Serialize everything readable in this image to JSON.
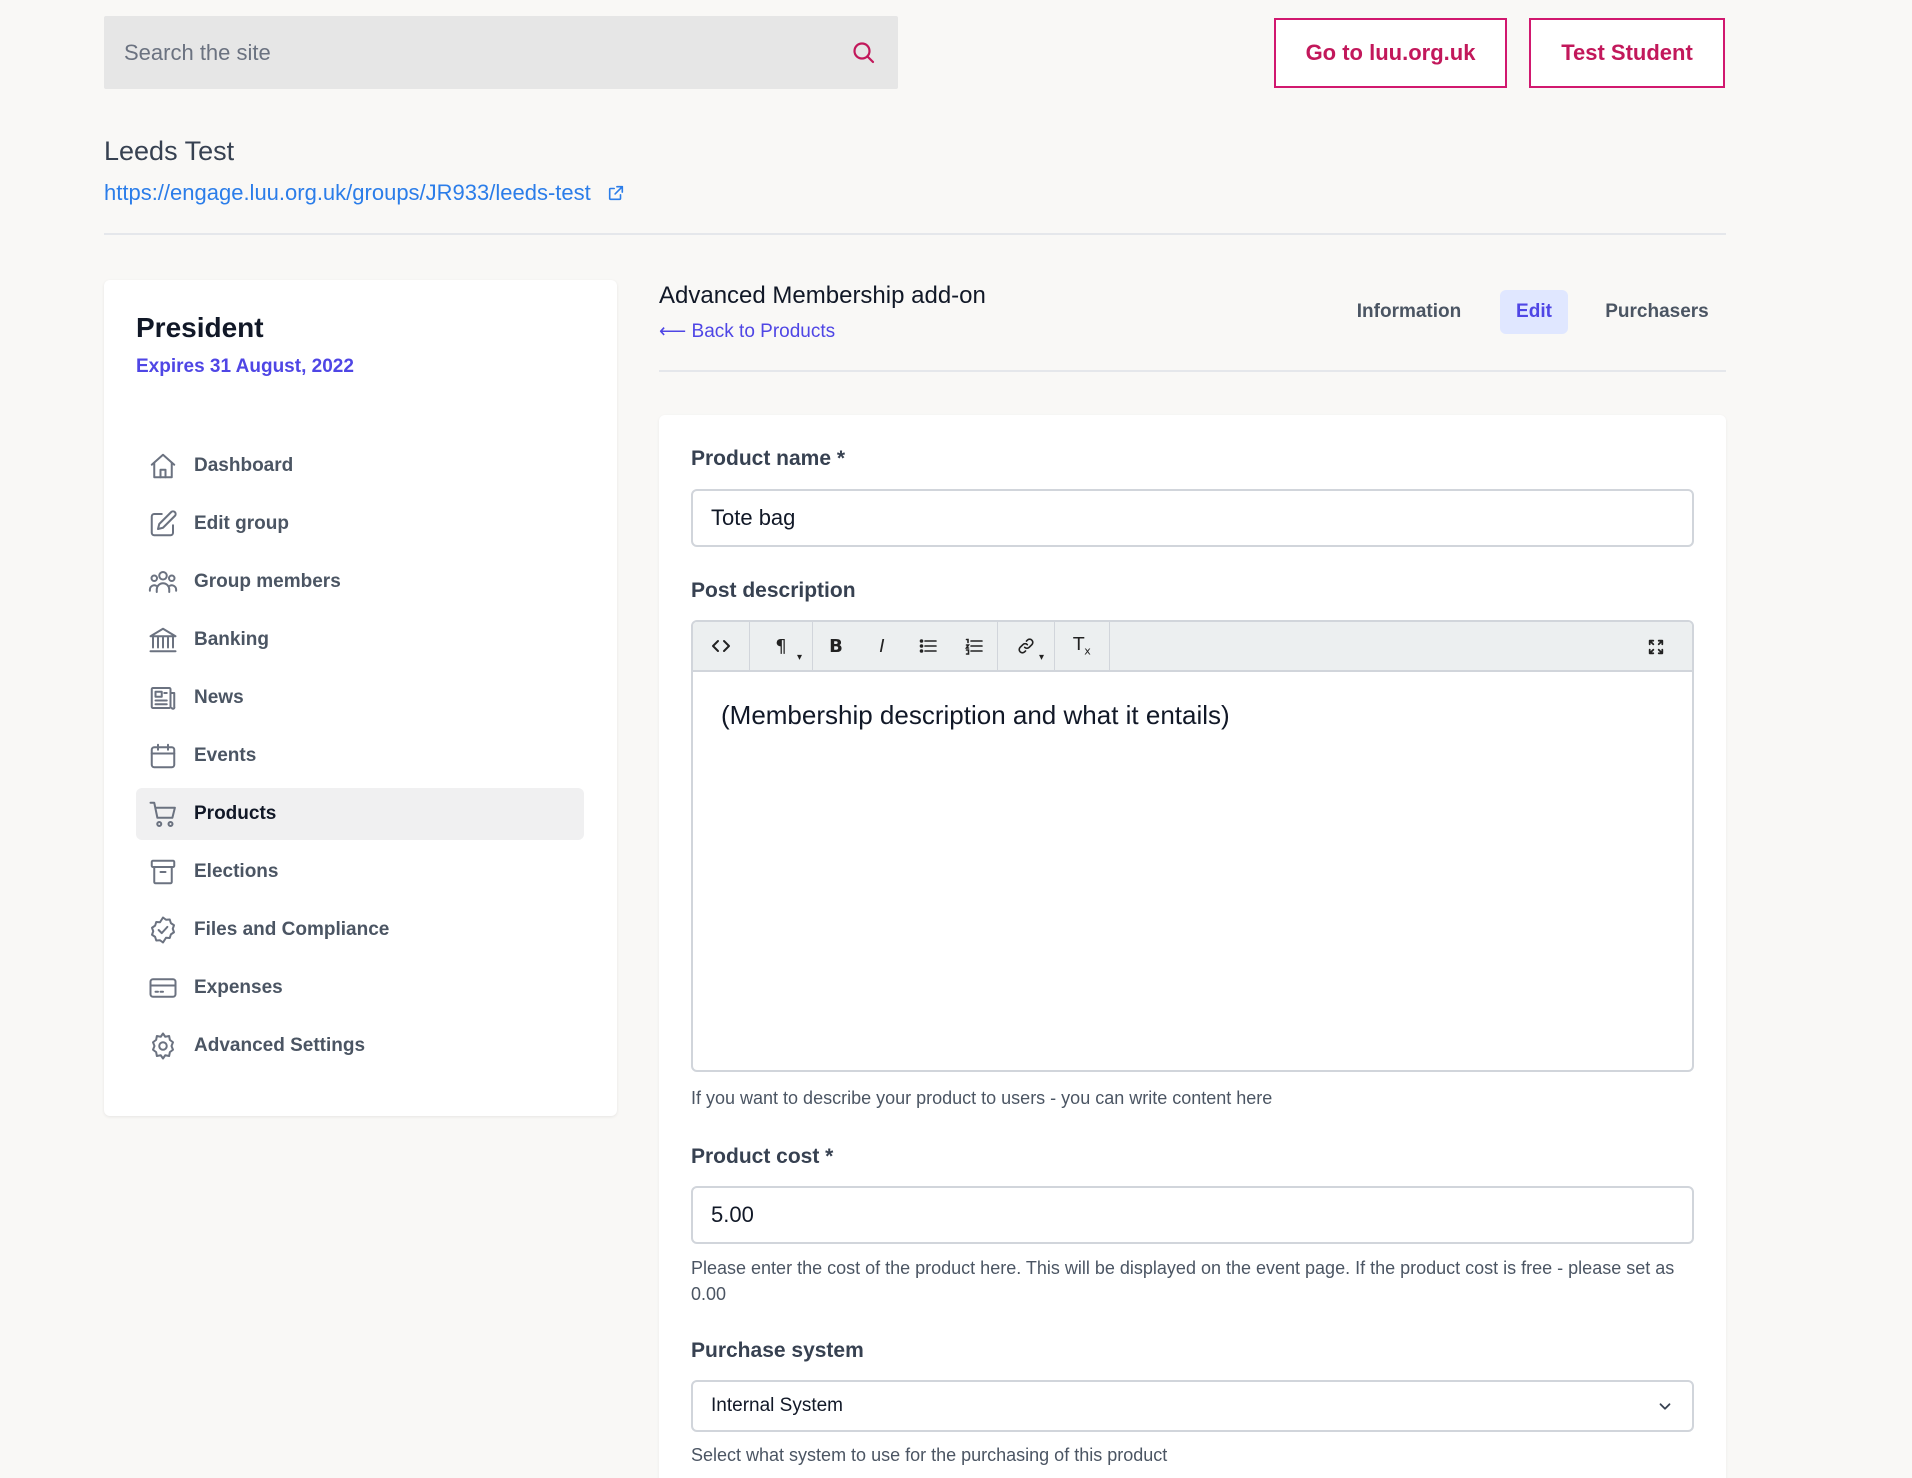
{
  "search": {
    "placeholder": "Search the site"
  },
  "header": {
    "luu_button": "Go to luu.org.uk",
    "user_button": "Test Student"
  },
  "group": {
    "title": "Leeds Test",
    "url": "https://engage.luu.org.uk/groups/JR933/leeds-test"
  },
  "sidebar": {
    "role": "President",
    "expires": "Expires 31 August, 2022",
    "items": [
      {
        "label": "Dashboard",
        "icon": "home-icon"
      },
      {
        "label": "Edit group",
        "icon": "edit-icon"
      },
      {
        "label": "Group members",
        "icon": "users-icon"
      },
      {
        "label": "Banking",
        "icon": "bank-icon"
      },
      {
        "label": "News",
        "icon": "newspaper-icon"
      },
      {
        "label": "Events",
        "icon": "calendar-icon"
      },
      {
        "label": "Products",
        "icon": "cart-icon",
        "active": true
      },
      {
        "label": "Elections",
        "icon": "archive-icon"
      },
      {
        "label": "Files and Compliance",
        "icon": "badge-check-icon"
      },
      {
        "label": "Expenses",
        "icon": "credit-card-icon"
      },
      {
        "label": "Advanced Settings",
        "icon": "gear-icon"
      }
    ]
  },
  "main": {
    "title": "Advanced Membership add-on",
    "back_link": "⟵ Back to Products",
    "tabs": [
      {
        "label": "Information"
      },
      {
        "label": "Edit",
        "active": true
      },
      {
        "label": "Purchasers"
      }
    ]
  },
  "form": {
    "product_name": {
      "label": "Product name *",
      "value": "Tote bag"
    },
    "description": {
      "label": "Post description",
      "content": "(Membership description and what it entails)",
      "help": "If you want to describe your product to users - you can write content here"
    },
    "cost": {
      "label": "Product cost *",
      "value": "5.00",
      "help": "Please enter the cost of the product here. This will be displayed on the event page. If the product cost is free - please set as 0.00"
    },
    "purchase_system": {
      "label": "Purchase system",
      "selected": "Internal System",
      "help": "Select what system to use for the purchasing of this product"
    }
  },
  "colors": {
    "accent_pink": "#c2185b",
    "accent_indigo": "#4f46e5",
    "link_blue": "#2b7de9"
  }
}
